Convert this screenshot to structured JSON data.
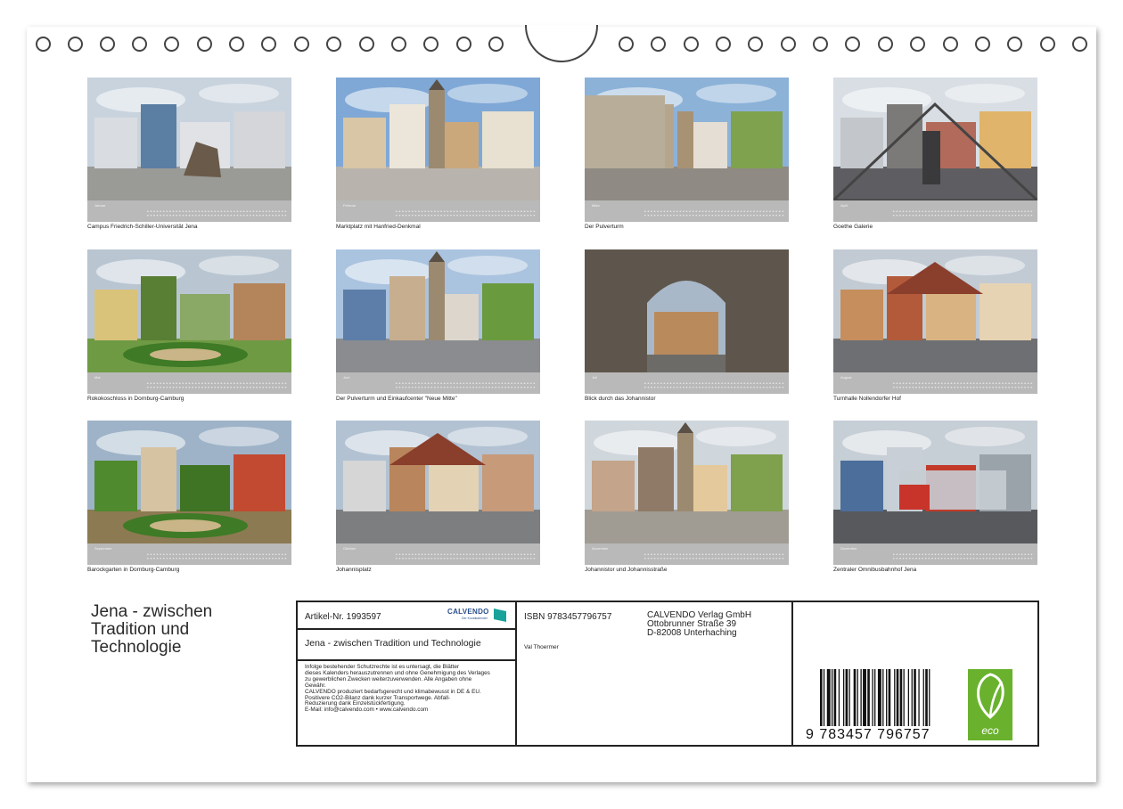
{
  "calendar_title": "Jena - zwischen Tradition und Technologie",
  "title_lines": [
    "Jena - zwischen",
    "Tradition und",
    "Technologie"
  ],
  "tiles": [
    {
      "month": "Januar",
      "caption": "Campus Friedrich-Schiller-Universität Jena"
    },
    {
      "month": "Februar",
      "caption": "Marktplatz mit Hanfried-Denkmal"
    },
    {
      "month": "März",
      "caption": "Der Pulverturm"
    },
    {
      "month": "April",
      "caption": "Goethe Galerie"
    },
    {
      "month": "Mai",
      "caption": "Rokokoschloss in Dornburg-Camburg"
    },
    {
      "month": "Juni",
      "caption": "Der Pulverturm und Einkaufcenter \"Neue Mitte\""
    },
    {
      "month": "Juli",
      "caption": "Blick durch das Johannistor"
    },
    {
      "month": "August",
      "caption": "Turnhalle Nollendorfer Hof"
    },
    {
      "month": "September",
      "caption": "Barockgarten in Dornburg-Camburg"
    },
    {
      "month": "Oktober",
      "caption": "Johannisplatz"
    },
    {
      "month": "November",
      "caption": "Johannistor und Johannisstraße"
    },
    {
      "month": "Dezember",
      "caption": "Zentraler Omnibusbahnhof Jena"
    }
  ],
  "info": {
    "article": "Artikel-Nr. 1993597",
    "logo_name": "CALVENDO",
    "logo_tagline": "Der Kunstkalender",
    "title": "Jena - zwischen Tradition und Technologie",
    "legal": "Infolge bestehender Schutzrechte ist es untersagt, die Blätter\ndieses Kalenders herauszutrennen und ohne Genehmigung des Verlages\nzu gewerblichen Zwecken weiterzuverwenden. Alle Angaben ohne\nGewähr.\nCALVENDO produziert bedarfsgerecht und klimabewusst in DE & EU.\nPositivere CO2-Bilanz dank kurzer Transportwege. Abfall-\nReduzierung dank Einzelstückfertigung.\nE-Mail: info@calvendo.com • www.calvendo.com",
    "isbn": "ISBN 9783457796757",
    "author": "Val Thoermer",
    "publisher_lines": [
      "CALVENDO Verlag GmbH",
      "Ottobrunner Straße 39",
      "D-82008 Unterhaching"
    ],
    "barcode_number": "9 783457 796757",
    "eco_label": "eco"
  },
  "colors": {
    "calendar_bar": "#b9b9b9",
    "eco_green": "#6ab22e",
    "logo_blue": "#2c4f8c"
  }
}
